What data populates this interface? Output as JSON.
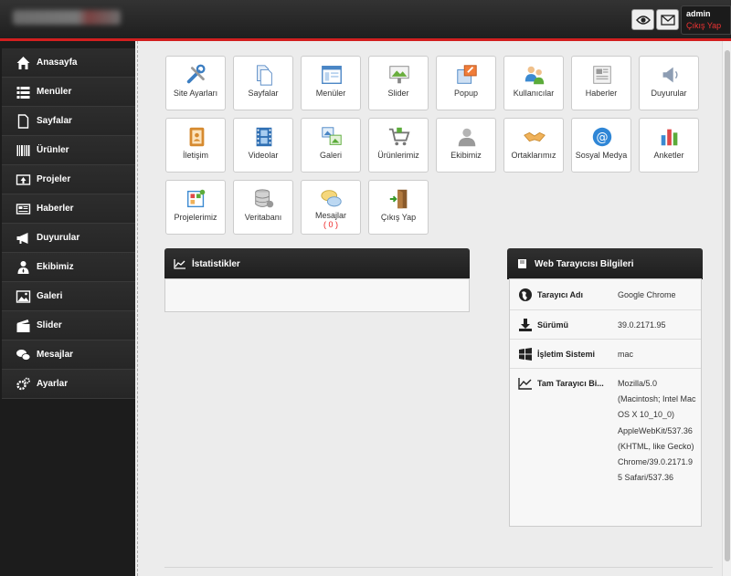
{
  "header": {
    "username": "admin",
    "logout_label": "Çıkış Yap",
    "accent_color": "#d21f1f"
  },
  "sidebar": {
    "items": [
      {
        "label": "Anasayfa",
        "icon": "home-icon"
      },
      {
        "label": "Menüler",
        "icon": "list-icon"
      },
      {
        "label": "Sayfalar",
        "icon": "page-icon"
      },
      {
        "label": "Ürünler",
        "icon": "barcode-icon"
      },
      {
        "label": "Projeler",
        "icon": "upload-icon"
      },
      {
        "label": "Haberler",
        "icon": "newspaper-icon"
      },
      {
        "label": "Duyurular",
        "icon": "megaphone-icon"
      },
      {
        "label": "Ekibimiz",
        "icon": "user-tie-icon"
      },
      {
        "label": "Galeri",
        "icon": "image-icon"
      },
      {
        "label": "Slider",
        "icon": "clapperboard-icon"
      },
      {
        "label": "Mesajlar",
        "icon": "chat-icon"
      },
      {
        "label": "Ayarlar",
        "icon": "gears-icon"
      }
    ]
  },
  "tiles": [
    {
      "label": "Site Ayarları",
      "icon": "tools-icon"
    },
    {
      "label": "Sayfalar",
      "icon": "documents-icon"
    },
    {
      "label": "Menüler",
      "icon": "window-icon"
    },
    {
      "label": "Slider",
      "icon": "slide-icon"
    },
    {
      "label": "Popup",
      "icon": "popup-icon"
    },
    {
      "label": "Kullanıcılar",
      "icon": "users-icon"
    },
    {
      "label": "Haberler",
      "icon": "news-icon"
    },
    {
      "label": "Duyurular",
      "icon": "speaker-icon"
    },
    {
      "label": "İletişim",
      "icon": "addressbook-icon"
    },
    {
      "label": "Videolar",
      "icon": "film-icon"
    },
    {
      "label": "Galeri",
      "icon": "gallery-icon"
    },
    {
      "label": "Ürünlerimiz",
      "icon": "cart-icon"
    },
    {
      "label": "Ekibimiz",
      "icon": "person-icon"
    },
    {
      "label": "Ortaklarımız",
      "icon": "handshake-icon"
    },
    {
      "label": "Sosyal Medya",
      "icon": "at-icon"
    },
    {
      "label": "Anketler",
      "icon": "barchart-icon"
    },
    {
      "label": "Projelerimiz",
      "icon": "project-icon"
    },
    {
      "label": "Veritabanı",
      "icon": "database-icon"
    },
    {
      "label": "Mesajlar",
      "icon": "bubbles-icon",
      "count": "( 0 )"
    },
    {
      "label": "Çıkış Yap",
      "icon": "exit-door-icon"
    }
  ],
  "stats_panel": {
    "title": "İstatistikler"
  },
  "browser_panel": {
    "title": "Web Tarayıcısı Bilgileri",
    "rows": [
      {
        "key": "Tarayıcı Adı",
        "value": "Google Chrome",
        "icon": "globe-icon"
      },
      {
        "key": "Sürümü",
        "value": "39.0.2171.95",
        "icon": "download-icon"
      },
      {
        "key": "İşletim Sistemi",
        "value": "mac",
        "icon": "windows-icon"
      },
      {
        "key": "Tam Tarayıcı Bi...",
        "value": "Mozilla/5.0 (Macintosh; Intel Mac OS X 10_10_0) AppleWebKit/537.36 (KHTML, like Gecko) Chrome/39.0.2171.95 Safari/537.36",
        "icon": "linechart-icon"
      }
    ]
  }
}
